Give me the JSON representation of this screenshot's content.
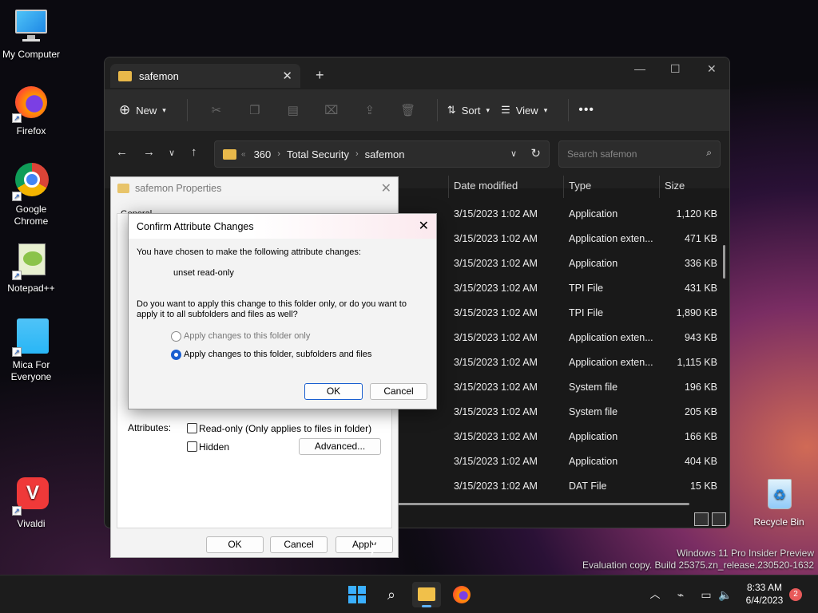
{
  "desktop": {
    "icons": [
      {
        "label": "My Computer"
      },
      {
        "label": "Firefox"
      },
      {
        "label": "Google Chrome"
      },
      {
        "label": "Notepad++"
      },
      {
        "label": "Mica For Everyone"
      },
      {
        "label": "Vivaldi"
      },
      {
        "label": "Recycle Bin"
      }
    ],
    "watermark_line1": "Windows 11 Pro Insider Preview",
    "watermark_line2": "Evaluation copy. Build 25375.zn_release.230520-1632"
  },
  "explorer": {
    "tab_title": "safemon",
    "toolbar": {
      "new": "New",
      "sort": "Sort",
      "view": "View"
    },
    "breadcrumb": [
      "360",
      "Total Security",
      "safemon"
    ],
    "search_placeholder": "Search safemon",
    "columns": {
      "date": "Date modified",
      "type": "Type",
      "size": "Size"
    },
    "rows": [
      {
        "date": "3/15/2023 1:02 AM",
        "type": "Application",
        "size": "1,120 KB"
      },
      {
        "date": "3/15/2023 1:02 AM",
        "type": "Application exten...",
        "size": "471 KB"
      },
      {
        "date": "3/15/2023 1:02 AM",
        "type": "Application",
        "size": "336 KB"
      },
      {
        "date": "3/15/2023 1:02 AM",
        "type": "TPI File",
        "size": "431 KB"
      },
      {
        "date": "3/15/2023 1:02 AM",
        "type": "TPI File",
        "size": "1,890 KB"
      },
      {
        "date": "3/15/2023 1:02 AM",
        "type": "Application exten...",
        "size": "943 KB"
      },
      {
        "date": "3/15/2023 1:02 AM",
        "type": "Application exten...",
        "size": "1,115 KB"
      },
      {
        "date": "3/15/2023 1:02 AM",
        "type": "System file",
        "size": "196 KB"
      },
      {
        "date": "3/15/2023 1:02 AM",
        "type": "System file",
        "size": "205 KB"
      },
      {
        "date": "3/15/2023 1:02 AM",
        "type": "Application",
        "size": "166 KB"
      },
      {
        "date": "3/15/2023 1:02 AM",
        "type": "Application",
        "size": "404 KB"
      },
      {
        "date": "3/15/2023 1:02 AM",
        "type": "DAT File",
        "size": "15 KB"
      }
    ]
  },
  "properties": {
    "title": "safemon Properties",
    "first_tab": "General",
    "attributes_label": "Attributes:",
    "readonly_label": "Read-only (Only applies to files in folder)",
    "hidden_label": "Hidden",
    "advanced_button": "Advanced...",
    "ok": "OK",
    "cancel": "Cancel",
    "apply": "Apply"
  },
  "confirm": {
    "title": "Confirm Attribute Changes",
    "intro": "You have chosen to make the following attribute changes:",
    "change": "unset read-only",
    "question_line1": "Do you want to apply this change to this folder only, or do you want to",
    "question_line2": "apply it to all subfolders and files as well?",
    "option_folder_only": "Apply changes to this folder only",
    "option_all": "Apply changes to this folder, subfolders and files",
    "ok": "OK",
    "cancel": "Cancel"
  },
  "taskbar": {
    "time": "8:33 AM",
    "date": "6/4/2023",
    "notification_count": "2"
  }
}
